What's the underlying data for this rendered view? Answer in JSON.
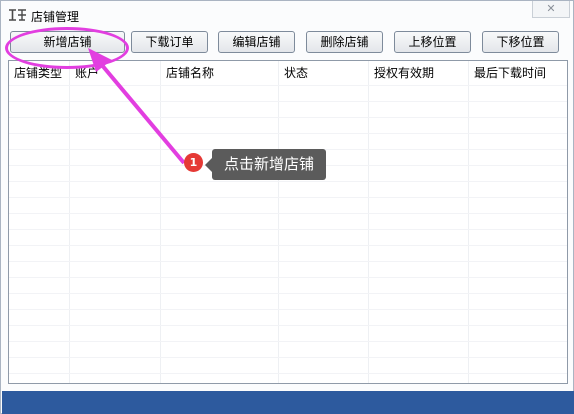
{
  "window": {
    "title": "店铺管理",
    "icon": "store-icon",
    "close_glyph": "✕"
  },
  "toolbar": {
    "buttons": [
      {
        "label": "新增店铺",
        "icon": null
      },
      {
        "label": "下载订单",
        "icon": null
      },
      {
        "label": "编辑店铺",
        "icon": null
      },
      {
        "label": "删除店铺",
        "icon": null
      },
      {
        "label": "上移位置",
        "icon": null
      },
      {
        "label": "下移位置",
        "icon": null
      }
    ]
  },
  "table": {
    "columns": [
      "店铺类型",
      "账户",
      "店铺名称",
      "状态",
      "授权有效期",
      "最后下载时间"
    ],
    "rows": []
  },
  "callout": {
    "step": "1",
    "text": "点击新增店铺",
    "color": "#e23ee0",
    "badge_color": "#e53935"
  },
  "colors": {
    "statusbar": "#2d5a9e",
    "tooltip_bg": "#5b5b5b"
  }
}
